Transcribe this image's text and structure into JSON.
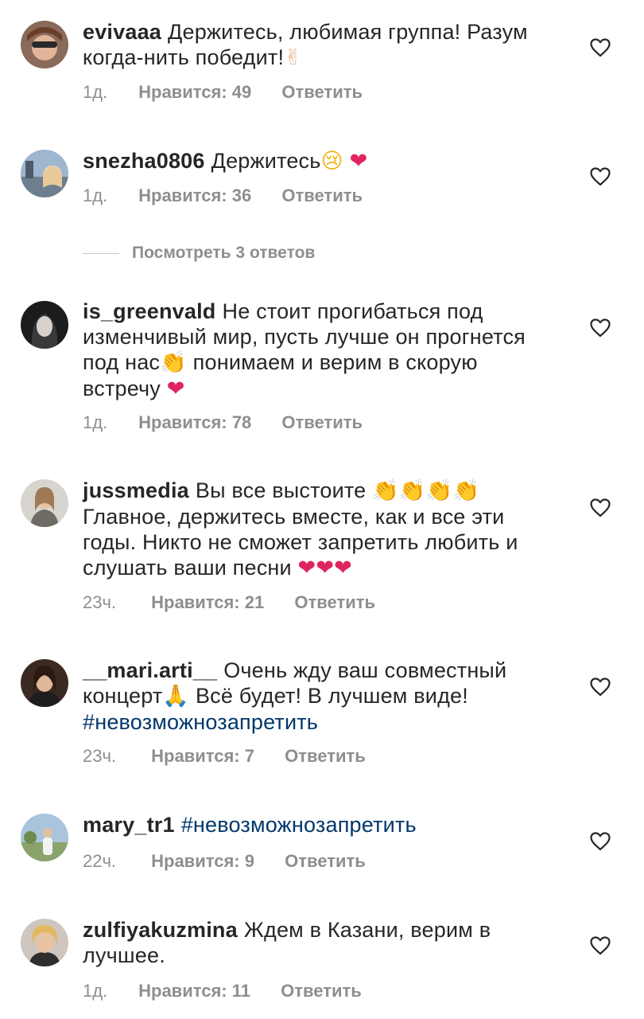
{
  "like_label": "Нравится:",
  "reply_label": "Ответить",
  "view_replies": "Посмотреть 3 ответов",
  "comments": [
    {
      "username": "evivaaa",
      "text_1": "Держитесь, любимая группа! Разум когда-нить победит!",
      "emoji_1": "✌",
      "time": "1д.",
      "likes": "49"
    },
    {
      "username": "snezha0806",
      "text_1": "Держитесь",
      "emoji_1": "😢",
      "emoji_2": "❤",
      "time": "1д.",
      "likes": "36"
    },
    {
      "username": "is_greenvald",
      "text_1": "Не стоит прогибаться под изменчивый мир, пусть лучше он прогнется под нас",
      "emoji_1": "👏",
      "text_2": "  понимаем и верим в скорую встречу",
      "emoji_2": "❤",
      "time": "1д.",
      "likes": "78"
    },
    {
      "username": "jussmedia",
      "text_1": "Вы все выстоите",
      "emoji_1": "👏👏👏👏",
      "text_2": "Главное, держитесь вместе, как и все эти годы. Никто не сможет запретить любить и слушать ваши песни",
      "emoji_2": "❤❤❤",
      "time": "23ч.",
      "likes": "21"
    },
    {
      "username": "__mari.arti__",
      "text_1": "Очень жду ваш совместный концерт",
      "emoji_1": "🙏",
      "text_2": " Всё будет! В лучшем виде!",
      "hashtag": "#невозможнозапретить",
      "time": "23ч.",
      "likes": "7"
    },
    {
      "username": "mary_tr1",
      "hashtag": "#невозможнозапретить",
      "time": "22ч.",
      "likes": "9"
    },
    {
      "username": "zulfiyakuzmina",
      "text_1": "Ждем в Казани, верим в лучшее.",
      "time": "1д.",
      "likes": "11"
    }
  ]
}
